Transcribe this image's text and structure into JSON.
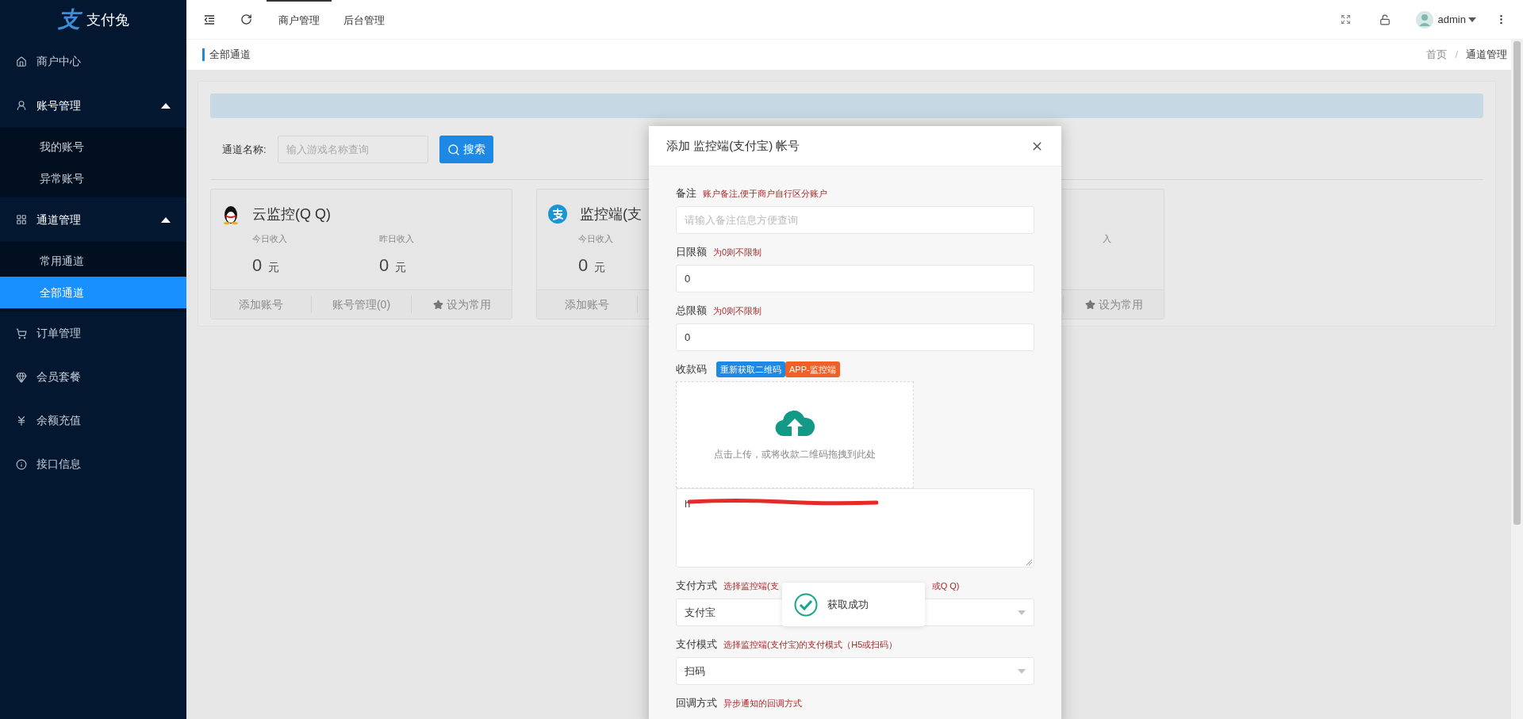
{
  "sidebar": {
    "logo_mark": "支",
    "logo_text": "支付兔",
    "items": [
      {
        "kind": "item",
        "label": "商户中心",
        "selected": false
      },
      {
        "kind": "group",
        "label": "账号管理",
        "expanded": true,
        "children": [
          {
            "label": "我的账号",
            "selected": false
          },
          {
            "label": "异常账号",
            "selected": false
          }
        ]
      },
      {
        "kind": "group",
        "label": "通道管理",
        "expanded": true,
        "children": [
          {
            "label": "常用通道",
            "selected": false
          },
          {
            "label": "全部通道",
            "selected": true
          }
        ]
      },
      {
        "kind": "item",
        "label": "订单管理",
        "selected": false
      },
      {
        "kind": "item",
        "label": "会员套餐",
        "selected": false
      },
      {
        "kind": "item",
        "label": "余额充值",
        "selected": false
      },
      {
        "kind": "item",
        "label": "接口信息",
        "selected": false
      }
    ]
  },
  "topbar": {
    "tabs": [
      {
        "label": "商户管理",
        "selected": true
      },
      {
        "label": "后台管理",
        "selected": false
      }
    ],
    "user": "admin"
  },
  "breadcrumb": {
    "page_title": "全部通道",
    "trail": [
      "首页",
      "通道管理"
    ],
    "separator": "/"
  },
  "search": {
    "label": "通道名称:",
    "placeholder": "输入游戏名称查询",
    "button": "搜索"
  },
  "cards": [
    {
      "kind": "qq",
      "title": "云监控(Q Q)",
      "today_label": "今日收入",
      "today_value": "0",
      "today_unit": "元",
      "yesterday_label": "昨日收入",
      "yesterday_value": "0",
      "yesterday_unit": "元",
      "actions": [
        {
          "kind": "add",
          "label": "添加账号"
        },
        {
          "kind": "manage",
          "label": "账号管理(0)"
        },
        {
          "kind": "favorite",
          "label": "设为常用"
        }
      ]
    },
    {
      "kind": "alipay",
      "title": "监控端(支",
      "today_label": "今日收入",
      "today_value": "0",
      "today_unit": "元",
      "actions": [
        {
          "kind": "add",
          "label": "添加账号"
        }
      ]
    },
    {
      "kind": "covered",
      "yesterday_label": "入",
      "actions": [
        {
          "kind": "favorite",
          "label": "设为常用"
        }
      ]
    }
  ],
  "modal": {
    "title": "添加 监控端(支付宝) 帐号",
    "fields": [
      {
        "kind": "input",
        "label": "备注",
        "hint": "账户备注,便于商户自行区分账户",
        "placeholder": "请输入备注信息方便查询"
      },
      {
        "kind": "input",
        "label": "日限额",
        "hint": "为0则不限制",
        "value": "0"
      },
      {
        "kind": "input",
        "label": "总限额",
        "hint": "为0则不限制",
        "value": "0"
      },
      {
        "kind": "qrcode",
        "label": "收款码",
        "tags": [
          {
            "label": "重新获取二维码",
            "color": "#1e88e5"
          },
          {
            "label": "APP-监控端",
            "color": "#f0612a"
          }
        ],
        "upload_text": "点击上传，或将收款二维码拖拽到此处",
        "url_value": "h"
      },
      {
        "kind": "select",
        "label": "支付方式",
        "hint_parts": [
          "选择监控端(支",
          "或Q Q)"
        ],
        "value": "支付宝"
      },
      {
        "kind": "select",
        "label": "支付模式",
        "hint": "选择监控端(支付宝)的支付模式（H5或扫码）",
        "value": "扫码"
      },
      {
        "kind": "label",
        "label": "回调方式",
        "hint": "异步通知的回调方式"
      }
    ]
  },
  "toast": {
    "text": "获取成功"
  }
}
